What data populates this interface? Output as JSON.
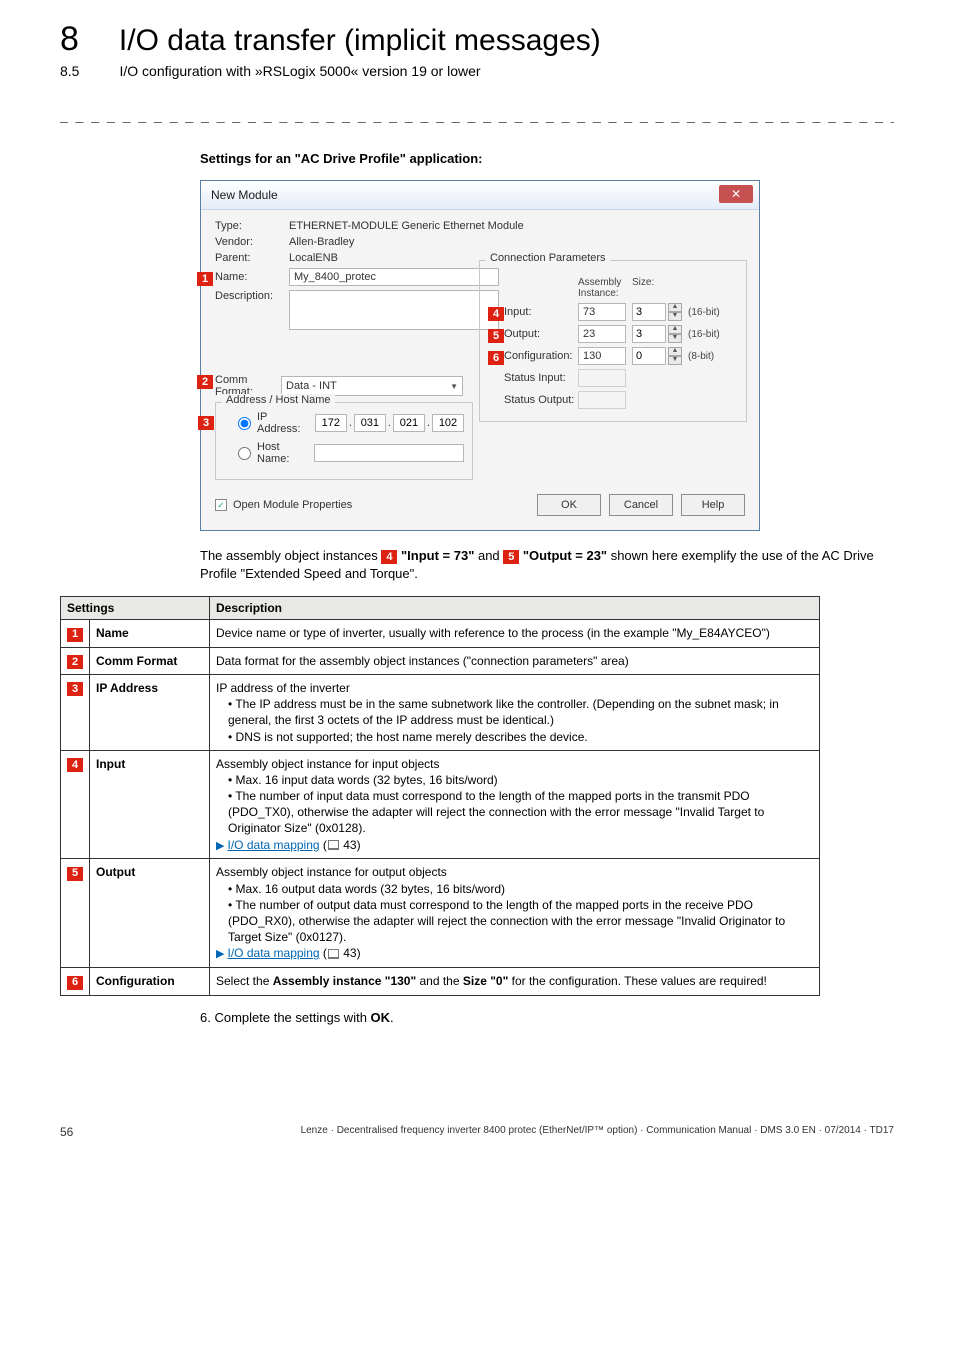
{
  "chapter": {
    "num": "8",
    "title": "I/O data transfer (implicit messages)",
    "subnum": "8.5",
    "subtitle": "I/O configuration with »RSLogix 5000« version 19 or lower"
  },
  "section_heading": "Settings for an \"AC Drive Profile\" application:",
  "dialog": {
    "title": "New Module",
    "type_lbl": "Type:",
    "type_val": "ETHERNET-MODULE Generic Ethernet Module",
    "vendor_lbl": "Vendor:",
    "vendor_val": "Allen-Bradley",
    "parent_lbl": "Parent:",
    "parent_val": "LocalENB",
    "name_lbl": "Name:",
    "name_val": "My_8400_protec",
    "desc_lbl": "Description:",
    "commfmt_lbl": "Comm Format:",
    "commfmt_val": "Data - INT",
    "addr_group": "Address / Host Name",
    "ip_lbl": "IP Address:",
    "ip": [
      "172",
      "031",
      "021",
      "102"
    ],
    "host_lbl": "Host Name:",
    "conn_title": "Connection Parameters",
    "col_asm": "Assembly\nInstance:",
    "col_size": "Size:",
    "input_lbl": "Input:",
    "input_inst": "73",
    "input_size": "3",
    "input_unit": "(16-bit)",
    "output_lbl": "Output:",
    "output_inst": "23",
    "output_size": "3",
    "output_unit": "(16-bit)",
    "config_lbl": "Configuration:",
    "config_inst": "130",
    "config_size": "0",
    "config_unit": "(8-bit)",
    "si_lbl": "Status Input:",
    "so_lbl": "Status Output:",
    "open_lbl": "Open Module Properties",
    "ok": "OK",
    "cancel": "Cancel",
    "help": "Help"
  },
  "caption": {
    "pre": "The assembly object instances ",
    "b1": " \"Input = 73\"",
    "mid": " and ",
    "b2": " \"Output = 23\"",
    "post": " shown here exemplify the use of the AC Drive Profile \"Extended Speed and Torque\"."
  },
  "table": {
    "hdr_settings": "Settings",
    "hdr_desc": "Description",
    "rows": [
      {
        "n": "1",
        "name": "Name",
        "desc": "Device name or type of inverter, usually with reference to the process (in the example \"My_E84AYCEO\")"
      },
      {
        "n": "2",
        "name": "Comm Format",
        "desc": "Data format for the assembly object instances (\"connection parameters\" area)"
      },
      {
        "n": "3",
        "name": "IP Address",
        "desc_line": "IP address of the inverter",
        "bul": [
          "The IP address must be in the same subnetwork like the controller. (Depending on the subnet mask; in general, the first 3 octets of the IP address must be identical.)",
          "DNS is not supported; the host name merely describes the device."
        ]
      },
      {
        "n": "4",
        "name": "Input",
        "desc_line": "Assembly object instance for input objects",
        "bul": [
          "Max. 16 input data words (32 bytes, 16 bits/word)",
          "The number of input data must correspond to the length of the mapped ports in the transmit PDO (PDO_TX0), otherwise the adapter will reject the connection with the error message \"Invalid Target to Originator Size\" (0x0128)."
        ],
        "link": "I/O data mapping",
        "link_pg": "43"
      },
      {
        "n": "5",
        "name": "Output",
        "desc_line": "Assembly object instance for output objects",
        "bul": [
          "Max. 16 output data words (32 bytes, 16 bits/word)",
          "The number of output data must correspond to the length of the mapped ports in the receive PDO (PDO_RX0), otherwise the adapter will reject the connection with the error message \"Invalid Originator to Target Size\" (0x0127)."
        ],
        "link": "I/O data mapping",
        "link_pg": "43"
      },
      {
        "n": "6",
        "name": "Configuration",
        "desc_html": "Select the <b>Assembly instance \"130\"</b> and the <b>Size \"0\"</b> for the configuration. These values are required!"
      }
    ]
  },
  "step6": "6.   Complete the settings with ",
  "step6_b": "OK",
  "footer": {
    "page": "56",
    "line": "Lenze · Decentralised frequency inverter 8400 protec (EtherNet/IP™ option) · Communication Manual · DMS 3.0 EN · 07/2014 · TD17"
  }
}
